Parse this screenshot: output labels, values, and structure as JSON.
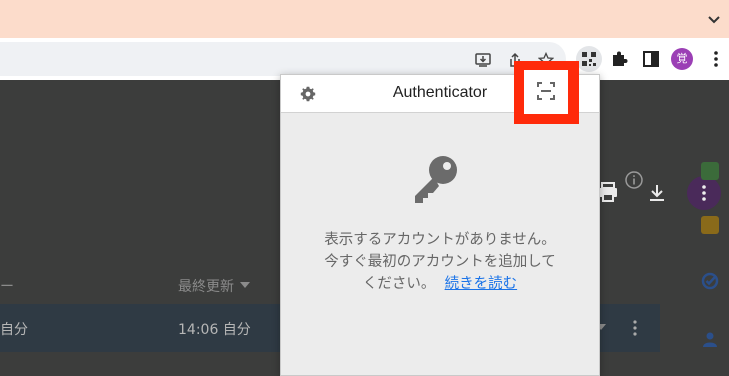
{
  "browser": {
    "profile_avatar": "覚",
    "colors": {
      "tabstrip": "#fcdccb",
      "avatar": "#9b3fb5",
      "highlight": "#ff2a0a",
      "link": "#1a73e8"
    }
  },
  "page": {
    "column_owner_partial": "ー",
    "column_last_modified": "最終更新",
    "row_owner_partial": "自分",
    "row_modified": "14:06 自分"
  },
  "popup": {
    "title": "Authenticator",
    "empty_line1": "表示するアカウントがありません。",
    "empty_line2": "今すぐ最初のアカウントを追加して",
    "empty_line3_prefix": "ください。",
    "learn_more_link": "続きを読む"
  },
  "icons": {
    "chevron": "chevron-down-icon",
    "install": "install-app-icon",
    "share": "share-icon",
    "bookmark": "star-icon",
    "qr_extension": "qr-extension-icon",
    "extensions": "puzzle-icon",
    "side_panel": "side-panel-icon",
    "menu": "more-vert-icon",
    "settings": "gear-icon",
    "key": "key-icon",
    "scan": "scan-qr-icon"
  }
}
